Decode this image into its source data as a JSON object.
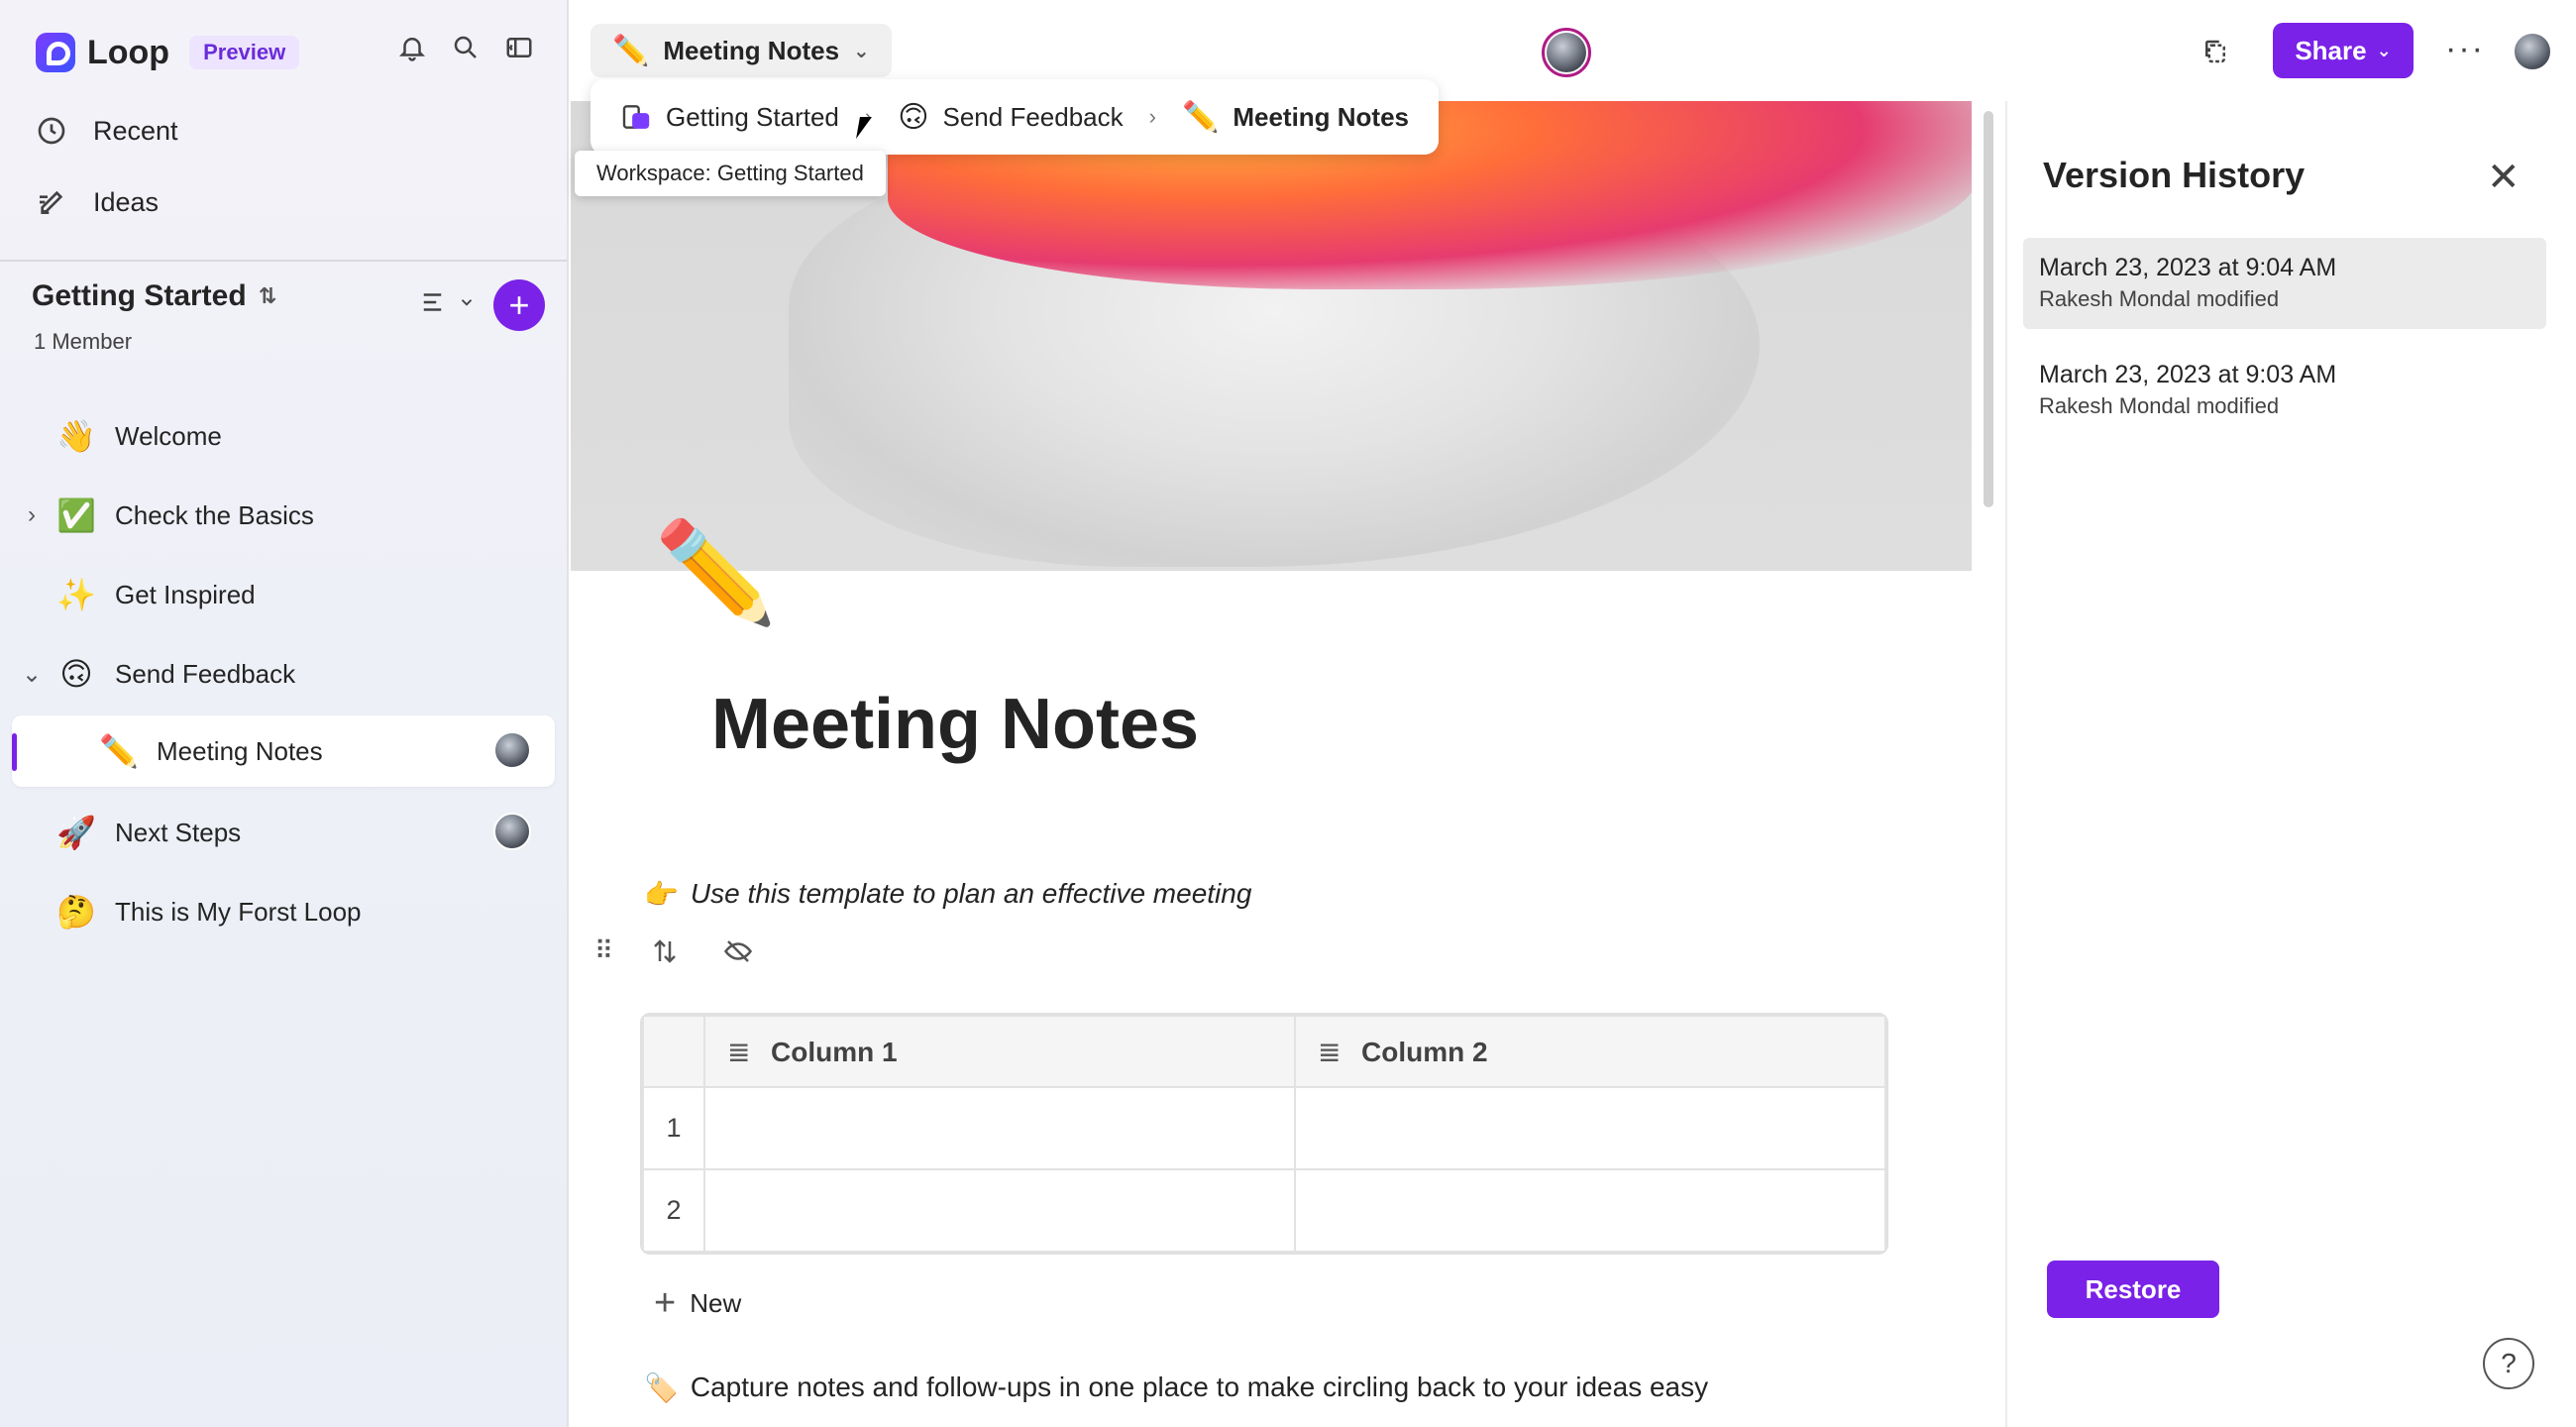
{
  "app": {
    "name": "Loop",
    "badge": "Preview"
  },
  "sidebar": {
    "nav": [
      {
        "label": "Recent",
        "icon": "clock-icon"
      },
      {
        "label": "Ideas",
        "icon": "pen-note-icon"
      }
    ],
    "workspace": {
      "title": "Getting Started",
      "members": "1 Member"
    },
    "pages": [
      {
        "label": "Welcome",
        "emoji": "👋"
      },
      {
        "label": "Check the Basics",
        "emoji": "✅"
      },
      {
        "label": "Get Inspired",
        "emoji": "✨"
      },
      {
        "label": "Send Feedback",
        "emoji": "🙃"
      },
      {
        "label": "Meeting Notes",
        "emoji": "✏️"
      },
      {
        "label": "Next Steps",
        "emoji": "🚀"
      },
      {
        "label": "This is My Forst Loop",
        "emoji": "🤔"
      }
    ]
  },
  "header": {
    "page_chip": "Meeting Notes",
    "breadcrumbs": [
      "Getting Started",
      "Send Feedback",
      "Meeting Notes"
    ],
    "tooltip": "Workspace: Getting Started",
    "share_label": "Share"
  },
  "doc": {
    "title": "Meeting Notes",
    "intro": "Use this template to plan an effective meeting",
    "intro_emoji": "👉",
    "table": {
      "columns": [
        "Column 1",
        "Column 2"
      ],
      "rows": [
        "1",
        "2"
      ]
    },
    "new_label": "New",
    "capture": "Capture notes and follow-ups in one place to make circling back to your ideas easy",
    "capture_emoji": "🏷️"
  },
  "version_history": {
    "title": "Version History",
    "entries": [
      {
        "date": "March 23, 2023 at 9:04 AM",
        "who": "Rakesh Mondal modified"
      },
      {
        "date": "March 23, 2023 at 9:03 AM",
        "who": "Rakesh Mondal modified"
      }
    ],
    "restore_label": "Restore",
    "help": "?"
  },
  "colors": {
    "accent": "#7a22e8"
  }
}
